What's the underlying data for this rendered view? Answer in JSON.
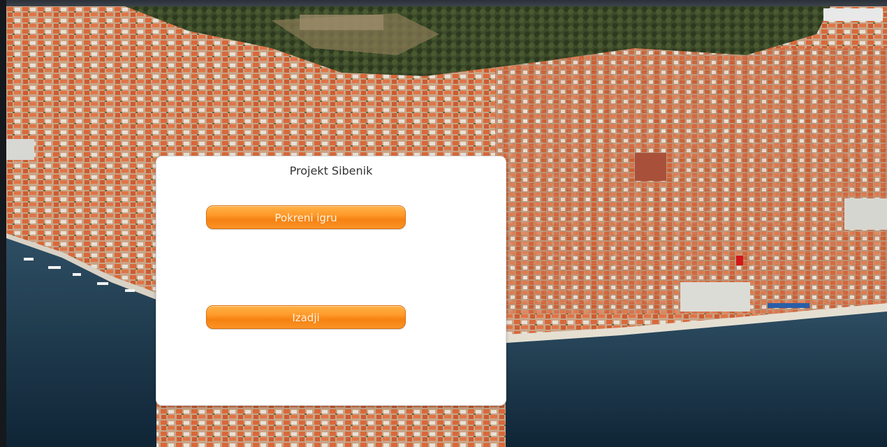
{
  "dialog": {
    "title": "Projekt Sibenik",
    "start_label": "Pokreni igru",
    "exit_label": "Izadji"
  },
  "background": {
    "description_icon": "aerial-city-photo"
  },
  "colors": {
    "button_orange": "#f7901e",
    "dialog_bg": "#ffffff",
    "sea": "#1f3a4d"
  }
}
